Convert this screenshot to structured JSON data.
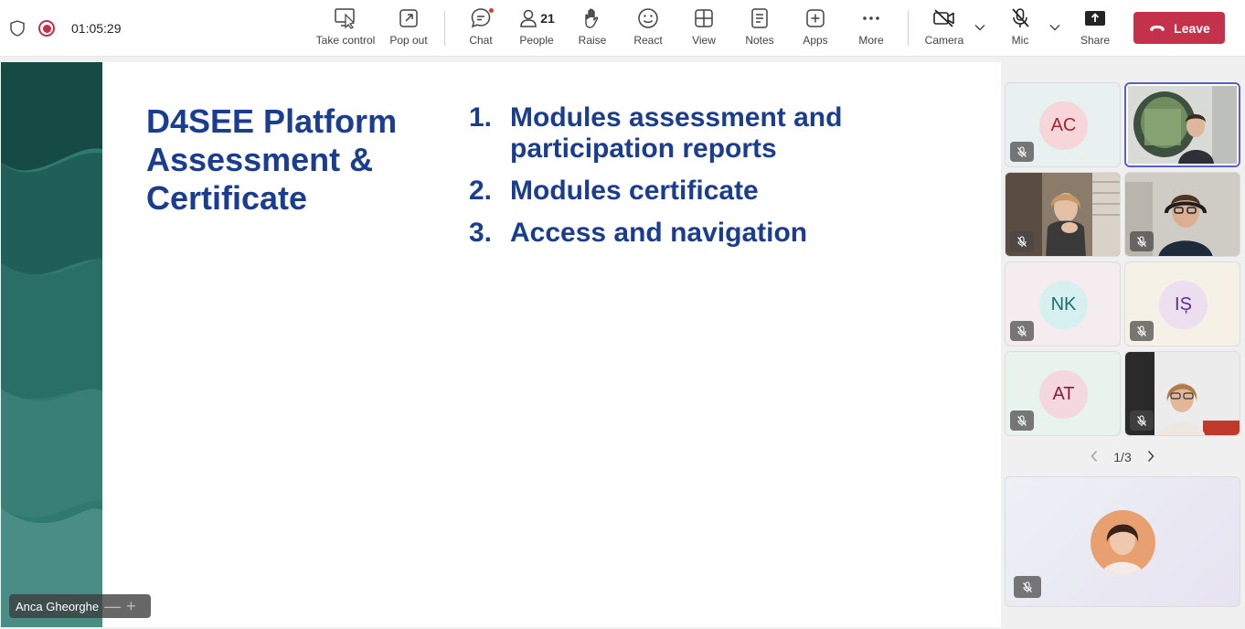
{
  "status": {
    "timer": "01:05:29"
  },
  "toolbar": {
    "take_control": "Take control",
    "pop_out": "Pop out",
    "chat": "Chat",
    "people": "People",
    "people_count": "21",
    "raise": "Raise",
    "react": "React",
    "view": "View",
    "notes": "Notes",
    "apps": "Apps",
    "more": "More",
    "camera": "Camera",
    "mic": "Mic",
    "share": "Share",
    "leave": "Leave"
  },
  "slide": {
    "title_lines": [
      "D4SEE Platform",
      "Assessment &",
      "Certificate"
    ],
    "items": [
      {
        "num": "1.",
        "text": "Modules assessment and participation reports"
      },
      {
        "num": "2.",
        "text": "Modules certificate"
      },
      {
        "num": "3.",
        "text": "Access and navigation"
      }
    ]
  },
  "presenter": {
    "name": "Anca Gheorghe"
  },
  "participants": [
    {
      "initials": "AC",
      "avatar_color": "#f6d6d8",
      "text_color": "#a4262c",
      "bg": "#e8f1ef",
      "muted": true
    },
    {
      "initials": "",
      "type": "video",
      "active_speaker": true
    },
    {
      "initials": "",
      "type": "video",
      "muted": true
    },
    {
      "initials": "",
      "type": "video",
      "muted": true
    },
    {
      "initials": "NK",
      "avatar_color": "#d6efef",
      "text_color": "#1f6e6e",
      "bg": "#f5ecef",
      "muted": true
    },
    {
      "initials": "IȘ",
      "avatar_color": "#ecdff0",
      "text_color": "#5c2e91",
      "bg": "#f5f1e6",
      "muted": true
    },
    {
      "initials": "AT",
      "avatar_color": "#f4d7df",
      "text_color": "#8a1e3f",
      "bg": "#e8f3ee",
      "muted": true
    },
    {
      "initials": "",
      "type": "video",
      "muted": true
    }
  ],
  "pagination": {
    "label": "1/3"
  },
  "colors": {
    "accent": "#5b5fc7",
    "leave": "#c4314b",
    "slide_text": "#1a3d8f",
    "slide_band": "#2f7a70"
  }
}
